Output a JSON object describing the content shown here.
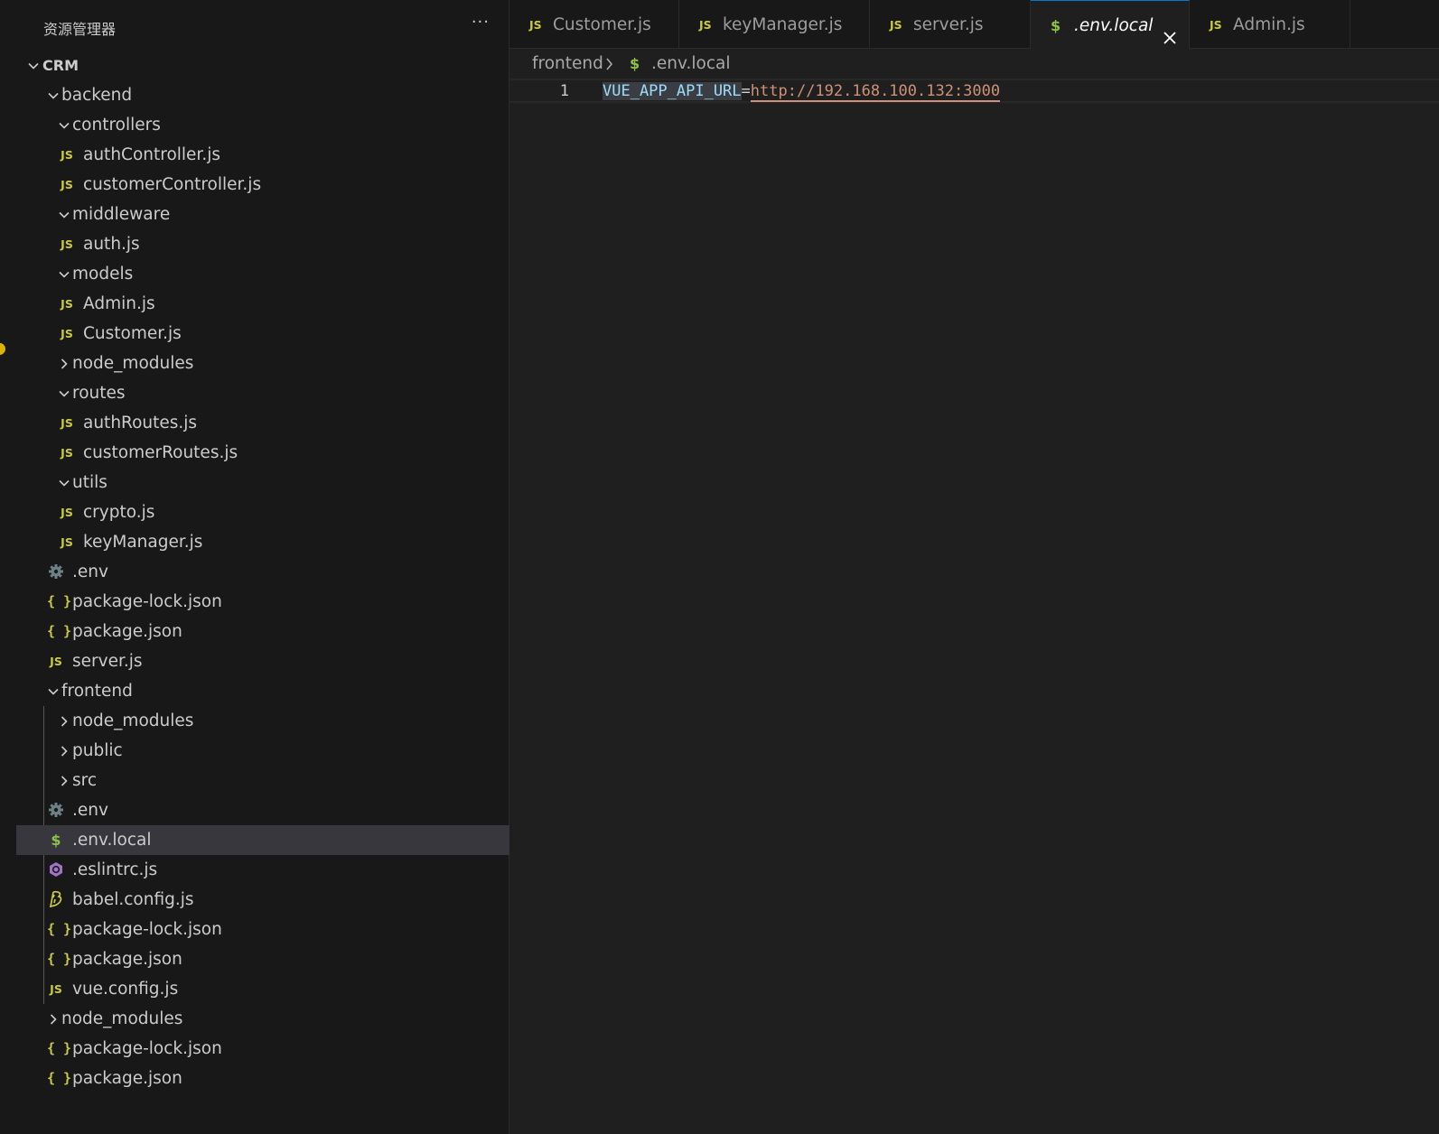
{
  "explorer": {
    "title": "资源管理器",
    "more_actions": "···"
  },
  "tree": [
    {
      "label": "CRM",
      "kind": "folder-open",
      "depth": 0,
      "root": true
    },
    {
      "label": "backend",
      "kind": "folder-open",
      "depth": 1
    },
    {
      "label": "controllers",
      "kind": "folder-open",
      "depth": 2
    },
    {
      "label": "authController.js",
      "kind": "js",
      "depth": 3
    },
    {
      "label": "customerController.js",
      "kind": "js",
      "depth": 3
    },
    {
      "label": "middleware",
      "kind": "folder-open",
      "depth": 2
    },
    {
      "label": "auth.js",
      "kind": "js",
      "depth": 3
    },
    {
      "label": "models",
      "kind": "folder-open",
      "depth": 2
    },
    {
      "label": "Admin.js",
      "kind": "js",
      "depth": 3
    },
    {
      "label": "Customer.js",
      "kind": "js",
      "depth": 3
    },
    {
      "label": "node_modules",
      "kind": "folder-closed",
      "depth": 2
    },
    {
      "label": "routes",
      "kind": "folder-open",
      "depth": 2
    },
    {
      "label": "authRoutes.js",
      "kind": "js",
      "depth": 3
    },
    {
      "label": "customerRoutes.js",
      "kind": "js",
      "depth": 3
    },
    {
      "label": "utils",
      "kind": "folder-open",
      "depth": 2
    },
    {
      "label": "crypto.js",
      "kind": "js",
      "depth": 3
    },
    {
      "label": "keyManager.js",
      "kind": "js",
      "depth": 3
    },
    {
      "label": ".env",
      "kind": "gear",
      "depth": 2
    },
    {
      "label": "package-lock.json",
      "kind": "json",
      "depth": 2
    },
    {
      "label": "package.json",
      "kind": "json",
      "depth": 2
    },
    {
      "label": "server.js",
      "kind": "js",
      "depth": 2
    },
    {
      "label": "frontend",
      "kind": "folder-open",
      "depth": 1
    },
    {
      "label": "node_modules",
      "kind": "folder-closed",
      "depth": 2
    },
    {
      "label": "public",
      "kind": "folder-closed",
      "depth": 2
    },
    {
      "label": "src",
      "kind": "folder-closed",
      "depth": 2
    },
    {
      "label": ".env",
      "kind": "gear",
      "depth": 2
    },
    {
      "label": ".env.local",
      "kind": "dollar",
      "depth": 2,
      "selected": true
    },
    {
      "label": ".eslintrc.js",
      "kind": "eslint",
      "depth": 2
    },
    {
      "label": "babel.config.js",
      "kind": "babel",
      "depth": 2
    },
    {
      "label": "package-lock.json",
      "kind": "json",
      "depth": 2
    },
    {
      "label": "package.json",
      "kind": "json",
      "depth": 2
    },
    {
      "label": "vue.config.js",
      "kind": "js",
      "depth": 2
    },
    {
      "label": "node_modules",
      "kind": "folder-closed",
      "depth": 1
    },
    {
      "label": "package-lock.json",
      "kind": "json",
      "depth": 1
    },
    {
      "label": "package.json",
      "kind": "json",
      "depth": 1
    }
  ],
  "tabs": [
    {
      "label": "Customer.js",
      "icon": "js",
      "active": false
    },
    {
      "label": "keyManager.js",
      "icon": "js",
      "active": false
    },
    {
      "label": "server.js",
      "icon": "js",
      "active": false
    },
    {
      "label": ".env.local",
      "icon": "dollar",
      "active": true
    },
    {
      "label": "Admin.js",
      "icon": "js",
      "active": false
    }
  ],
  "icons": {
    "js": "JS",
    "json": "{ }",
    "dollar": "$"
  },
  "breadcrumb": {
    "folder": "frontend",
    "file": ".env.local"
  },
  "editor": {
    "line_number": "1",
    "key": "VUE_APP_API_URL",
    "equals": "=",
    "value": "http://192.168.100.132:3000"
  },
  "colors": {
    "accent": "#0078d4",
    "js_icon": "#cbcb41",
    "env_icon": "#8dc149",
    "eslint_icon": "#a074c4",
    "gear_icon": "#6d8086",
    "selection": "#37373d",
    "string": "#ce9178",
    "variable": "#9cdcfe"
  }
}
